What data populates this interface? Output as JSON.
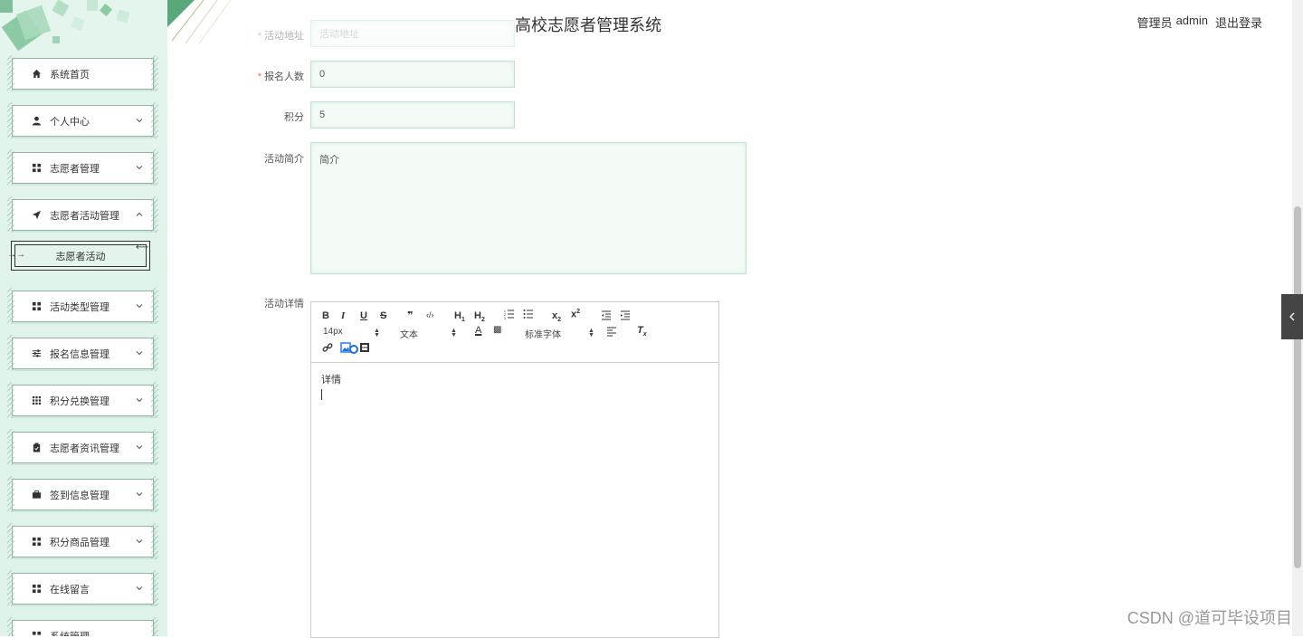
{
  "header": {
    "title": "高校志愿者管理系统",
    "user_role": "管理员",
    "username": "admin",
    "logout_label": "退出登录"
  },
  "sidebar": {
    "items": [
      {
        "label": "系统首页",
        "icon": "home-icon"
      },
      {
        "label": "个人中心",
        "icon": "user-icon"
      },
      {
        "label": "志愿者管理",
        "icon": "grid-icon"
      },
      {
        "label": "志愿者活动管理",
        "icon": "send-icon"
      },
      {
        "label": "活动类型管理",
        "icon": "grid-icon"
      },
      {
        "label": "报名信息管理",
        "icon": "sliders-icon"
      },
      {
        "label": "积分兑换管理",
        "icon": "apps-icon"
      },
      {
        "label": "志愿者资讯管理",
        "icon": "clipboard-icon"
      },
      {
        "label": "签到信息管理",
        "icon": "briefcase-icon"
      },
      {
        "label": "积分商品管理",
        "icon": "grid-icon"
      },
      {
        "label": "在线留言",
        "icon": "grid-icon"
      },
      {
        "label": "系统管理",
        "icon": "grid-icon"
      }
    ],
    "submenu": {
      "label": "志愿者活动"
    }
  },
  "form": {
    "address": {
      "label": "活动地址",
      "placeholder": "活动地址"
    },
    "signup_count": {
      "label": "报名人数",
      "value": "0"
    },
    "points": {
      "label": "积分",
      "value": "5"
    },
    "intro": {
      "label": "活动简介",
      "value": "简介"
    },
    "details": {
      "label": "活动详情",
      "content": "详情"
    }
  },
  "editor": {
    "font_size": "14px",
    "header_type": "文本",
    "font_family": "标准字体",
    "buttons": [
      "B",
      "I",
      "U",
      "S",
      "❞",
      "‹/›",
      "H1",
      "H2",
      "ol",
      "ul",
      "x₂",
      "x²",
      "outdent",
      "indent"
    ]
  },
  "watermark": "CSDN @道可毕设项目"
}
